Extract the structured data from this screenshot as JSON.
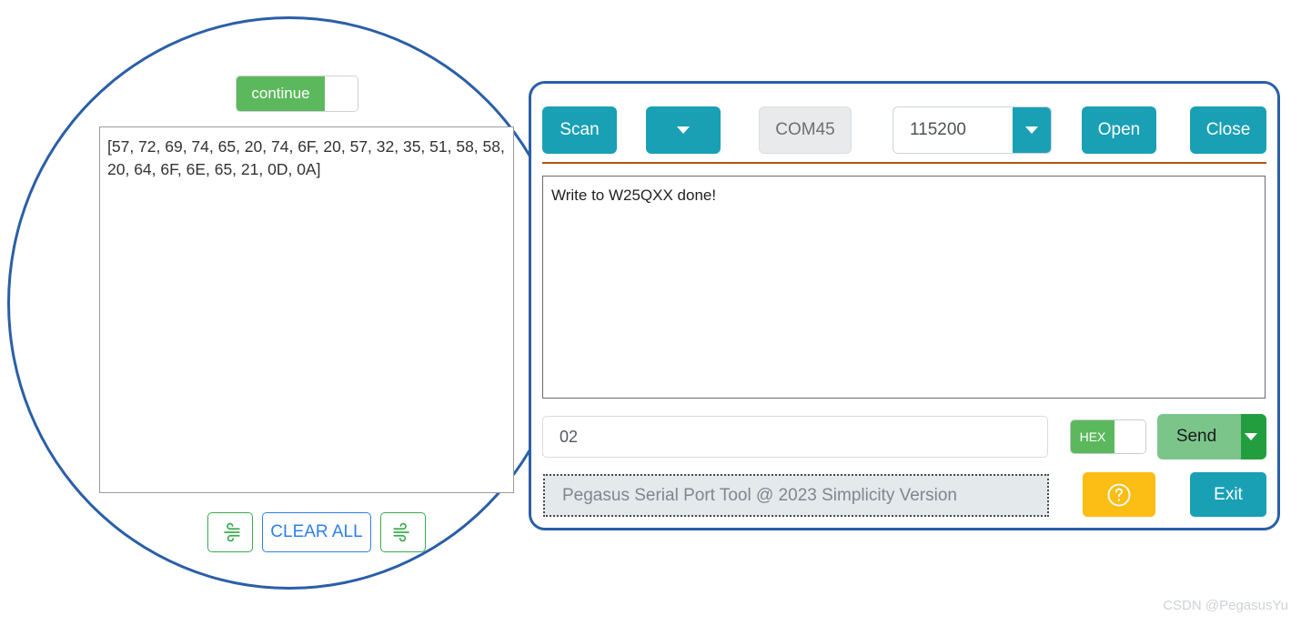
{
  "app": {
    "window_border_color": "#2a5fa8",
    "accent_teal": "#19a0b5",
    "accent_green": "#239e3f",
    "accent_amber": "#fcbd14",
    "divider_color": "#b3560f"
  },
  "toolbar": {
    "scan_label": "Scan",
    "port_dropdown_icon": "chevron-down-icon",
    "com_port_value": "COM45",
    "baud_rate_value": "115200",
    "baud_dropdown_icon": "chevron-down-icon",
    "open_label": "Open",
    "close_label": "Close"
  },
  "receive": {
    "text": "Write to W25QXX done!"
  },
  "send": {
    "input_value": "02",
    "input_placeholder": "",
    "hex_toggle_label": "HEX",
    "hex_toggle_state": "on",
    "send_label": "Send",
    "send_dropdown_icon": "chevron-down-icon"
  },
  "status": {
    "text": "Pegasus Serial Port Tool @ 2023 Simplicity Version"
  },
  "actions": {
    "help_icon": "question-circle-icon",
    "exit_label": "Exit"
  },
  "callout": {
    "continue_toggle_label": "continue",
    "continue_toggle_state": "on",
    "hex_dump_text": "[57, 72, 69, 74, 65, 20, 74, 6F, 20, 57, 32, 35, 51, 58, 58, 20, 64, 6F, 6E, 65, 21, 0D, 0A]",
    "wind_left_icon": "wind-icon",
    "clear_all_label": "CLEAR ALL",
    "wind_right_icon": "wind-icon"
  },
  "watermark": {
    "text": "CSDN @PegasusYu"
  }
}
